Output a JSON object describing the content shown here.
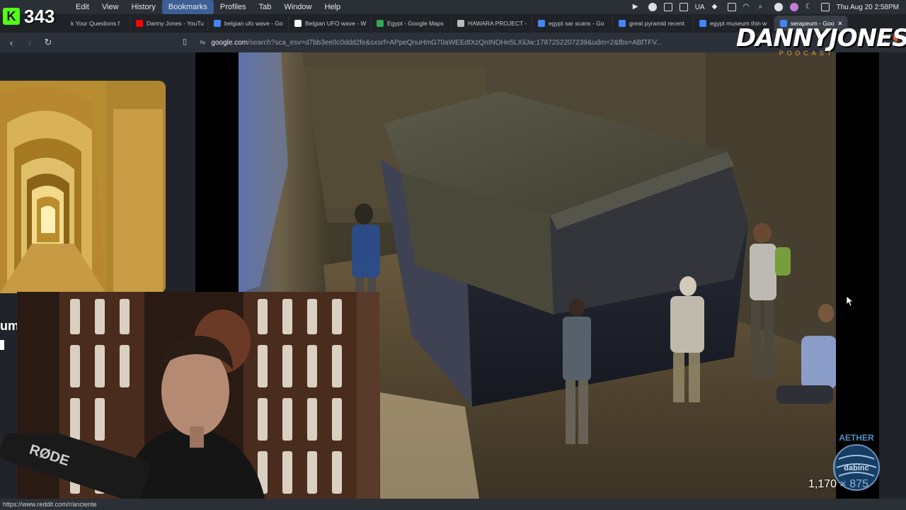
{
  "menubar": {
    "items": [
      "Edit",
      "View",
      "History",
      "Bookmarks",
      "Profiles",
      "Tab",
      "Window",
      "Help"
    ],
    "active_index": 3,
    "status_text": "UA",
    "clock": "Thu Aug 20  2:58PM"
  },
  "kick_badge": {
    "letter": "K",
    "count": "343"
  },
  "tabs": [
    {
      "label": "k Your Questions f",
      "color": "#888888"
    },
    {
      "label": "Danny Jones - YouTu",
      "color": "#ff0000"
    },
    {
      "label": "belgian ufo wave - Go",
      "color": "#4285f4"
    },
    {
      "label": "Belgian UFO wave - W",
      "color": "#ffffff"
    },
    {
      "label": "Egypt - Google Maps",
      "color": "#34a853"
    },
    {
      "label": "HAWARA PROJECT -",
      "color": "#bbbbbb"
    },
    {
      "label": "egypt sar scans - Go",
      "color": "#4285f4"
    },
    {
      "label": "great pyramid recent",
      "color": "#4285f4"
    },
    {
      "label": "egypt museum thin w",
      "color": "#4285f4"
    },
    {
      "label": "serapeum - Goo",
      "color": "#4285f4",
      "active": true
    }
  ],
  "address": {
    "host": "google.com",
    "path": "/search?sca_esv=d7bb3ee0c0ddd2fe&sxsrf=APpeQnuHmG70aWEEdtXzQnINOHe5LXilJw:1787252207239&udm=2&fbs=ABfTFV..."
  },
  "content": {
    "partial_left_text": "um",
    "image_size_label": "1,170 × 875"
  },
  "logos": {
    "podcast_name": "DANNYJONES",
    "podcast_sub": "PODCAST",
    "watermark_top": "AETHER",
    "watermark_mid": "dabinc"
  },
  "webcam": {
    "mic_brand": "RØDE"
  },
  "statusbar": {
    "link": "https://www.reddit.com/r/anciente"
  },
  "colors": {
    "kick_green": "#53fc18",
    "menu_active": "#3c5f95",
    "podcast_accent": "#e89a3c"
  }
}
